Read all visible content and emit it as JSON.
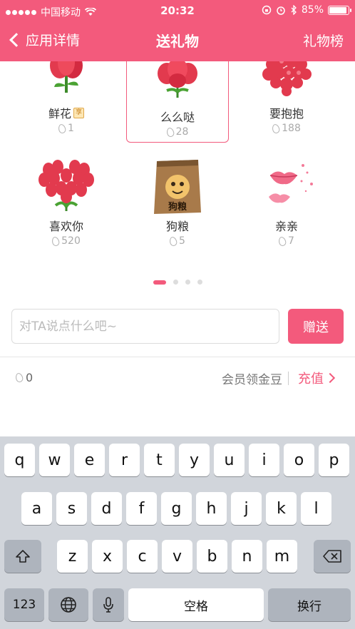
{
  "status_bar": {
    "carrier": "中国移动",
    "time": "20:32",
    "battery_percent": "85%",
    "battery_level": 0.85
  },
  "nav": {
    "back_label": "应用详情",
    "title": "送礼物",
    "right_label": "礼物榜"
  },
  "gifts": [
    {
      "name": "鲜花",
      "price": "1",
      "badge": "享",
      "selected": false
    },
    {
      "name": "么么哒",
      "price": "28",
      "selected": true
    },
    {
      "name": "要抱抱",
      "price": "188",
      "selected": false
    },
    {
      "name": "喜欢你",
      "price": "520",
      "selected": false
    },
    {
      "name": "狗粮",
      "price": "5",
      "image_text": "狗粮",
      "selected": false
    },
    {
      "name": "亲亲",
      "price": "7",
      "selected": false
    }
  ],
  "pager": {
    "current": 1,
    "total": 4
  },
  "message": {
    "placeholder": "对TA说点什么吧~",
    "value": "",
    "send_label": "赠送"
  },
  "footer": {
    "balance": "0",
    "vip_gold_label": "会员领金豆",
    "recharge_label": "充值"
  },
  "keyboard": {
    "row1": [
      "q",
      "w",
      "e",
      "r",
      "t",
      "y",
      "u",
      "i",
      "o",
      "p"
    ],
    "row2": [
      "a",
      "s",
      "d",
      "f",
      "g",
      "h",
      "j",
      "k",
      "l"
    ],
    "row3": [
      "z",
      "x",
      "c",
      "v",
      "b",
      "n",
      "m"
    ],
    "numbers_key": "123",
    "space_key": "空格",
    "return_key": "换行"
  },
  "colors": {
    "accent": "#f35a7c",
    "keyboard_bg": "#d1d5db"
  }
}
